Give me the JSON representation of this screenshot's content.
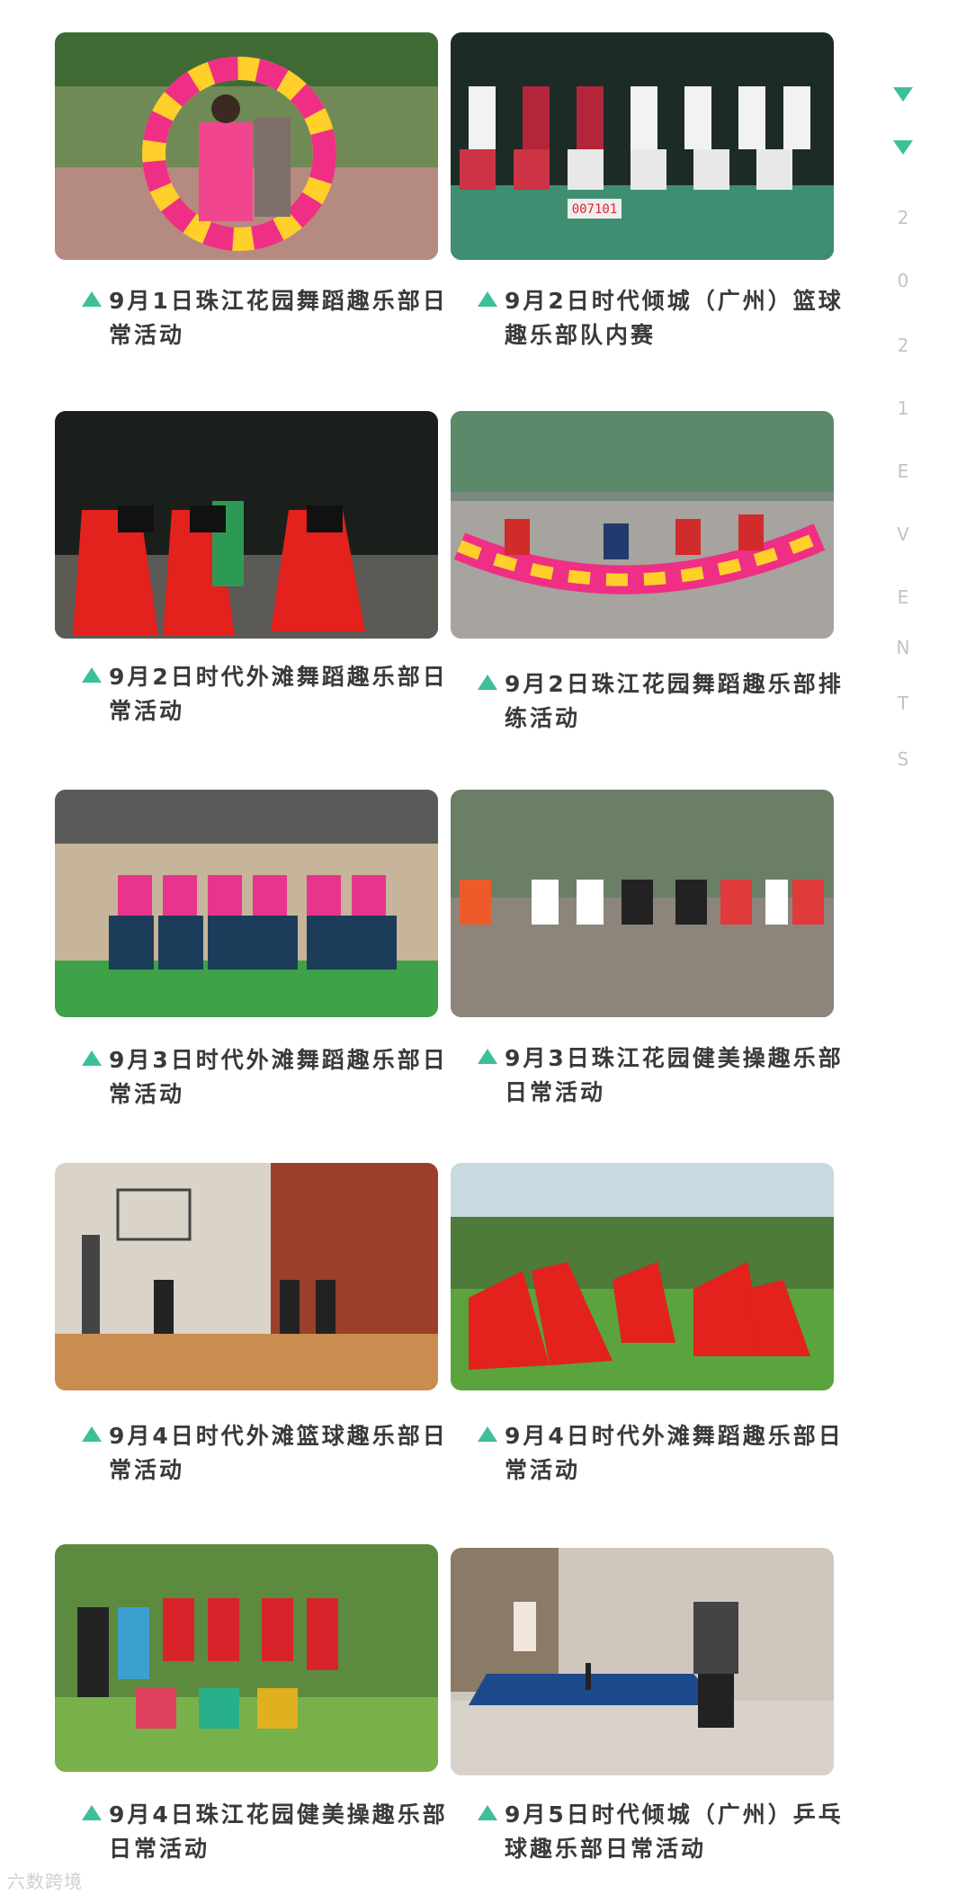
{
  "accent_color": "#3dbf9a",
  "side_label": {
    "icons": [
      "down-triangle-icon",
      "down-triangle-icon"
    ],
    "letters": [
      "2",
      "0",
      "2",
      "1",
      "E",
      "V",
      "E",
      "N",
      "T",
      "S"
    ]
  },
  "cards": [
    {
      "photo": "dance-fans-photo",
      "caption": "9月1日珠江花园舞蹈趣乐部日常活动"
    },
    {
      "photo": "basketball-team-photo",
      "caption": "9月2日时代倾城（广州）篮球趣乐部队内赛"
    },
    {
      "photo": "night-dance-photo",
      "caption": "9月2日时代外滩舞蹈趣乐部日常活动"
    },
    {
      "photo": "fan-rehearsal-photo",
      "caption": "9月2日珠江花园舞蹈趣乐部排练活动"
    },
    {
      "photo": "pink-dancers-photo",
      "caption": "9月3日时代外滩舞蹈趣乐部日常活动"
    },
    {
      "photo": "aerobics-photo",
      "caption": "9月3日珠江花园健美操趣乐部日常活动"
    },
    {
      "photo": "indoor-basketball-photo",
      "caption": "9月4日时代外滩篮球趣乐部日常活动"
    },
    {
      "photo": "red-skirt-dance-photo",
      "caption": "9月4日时代外滩舞蹈趣乐部日常活动"
    },
    {
      "photo": "group-portrait-photo",
      "caption": "9月4日珠江花园健美操趣乐部日常活动"
    },
    {
      "photo": "table-tennis-photo",
      "caption": "9月5日时代倾城（广州）乒乓球趣乐部日常活动"
    }
  ],
  "scoreboard": "007101",
  "watermark": "六数跨境"
}
